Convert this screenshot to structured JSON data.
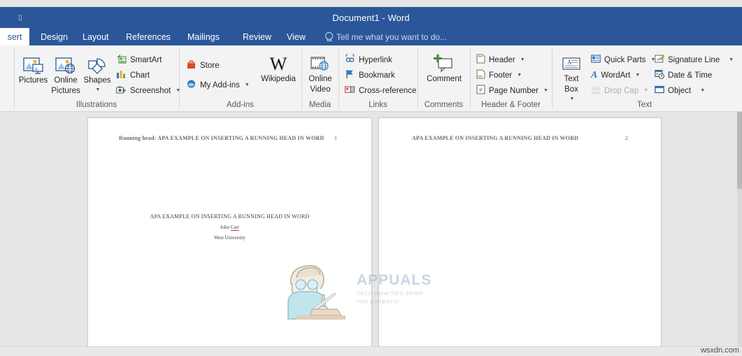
{
  "window": {
    "title": "Document1 - Word",
    "quick_access_icon": "customize-quick-access-toolbar-icon",
    "accent_color": "#2b579a"
  },
  "tabs": [
    {
      "label": "sert",
      "active": true,
      "name": "tab-insert"
    },
    {
      "label": "Design",
      "active": false,
      "name": "tab-design"
    },
    {
      "label": "Layout",
      "active": false,
      "name": "tab-layout"
    },
    {
      "label": "References",
      "active": false,
      "name": "tab-references"
    },
    {
      "label": "Mailings",
      "active": false,
      "name": "tab-mailings"
    },
    {
      "label": "Review",
      "active": false,
      "name": "tab-review"
    },
    {
      "label": "View",
      "active": false,
      "name": "tab-view"
    }
  ],
  "tell_me": {
    "label": "Tell me what you want to do...",
    "icon": "lightbulb-icon"
  },
  "ribbon": {
    "groups": [
      {
        "label": "Illustrations"
      },
      {
        "label": "Add-ins"
      },
      {
        "label": "Media"
      },
      {
        "label": "Links"
      },
      {
        "label": "Comments"
      },
      {
        "label": "Header & Footer"
      },
      {
        "label": "Text"
      }
    ],
    "illustrations": {
      "pictures": "Pictures",
      "online_pictures": "Online\nPictures",
      "online_pictures_l1": "Online",
      "online_pictures_l2": "Pictures",
      "shapes": "Shapes",
      "smartart": "SmartArt",
      "chart": "Chart",
      "screenshot": "Screenshot"
    },
    "addins": {
      "store": "Store",
      "my_addins": "My Add-ins",
      "wikipedia": "Wikipedia"
    },
    "media": {
      "online_video_l1": "Online",
      "online_video_l2": "Video"
    },
    "links": {
      "hyperlink": "Hyperlink",
      "bookmark": "Bookmark",
      "cross_reference": "Cross-reference"
    },
    "comments": {
      "comment": "Comment"
    },
    "header_footer": {
      "header": "Header",
      "footer": "Footer",
      "page_number": "Page Number"
    },
    "text": {
      "text_box_l1": "Text",
      "text_box_l2": "Box",
      "quick_parts": "Quick Parts",
      "wordart": "WordArt",
      "drop_cap": "Drop Cap",
      "signature_line": "Signature Line",
      "date_time": "Date & Time",
      "object": "Object"
    }
  },
  "document": {
    "page1": {
      "running_head": "Running head: APA EXAMPLE ON INSERTING A RUNNING HEAD IN WORD",
      "page_number": "1",
      "title": "APA EXAMPLE ON INSERTING A RUNNING HEAD IN WORD",
      "author": "John Carr",
      "affiliation": "West University"
    },
    "page2": {
      "running_head": "APA EXAMPLE ON INSERTING A RUNNING HEAD IN WORD",
      "page_number": "2"
    }
  },
  "watermark": {
    "brand": "APPUALS",
    "tagline_line1": "TECH HOW-TO'S FROM",
    "tagline_line2": "THE EXPERTS!",
    "color": "#9db3cd"
  },
  "footer": {
    "source": "wsxdn.com"
  }
}
